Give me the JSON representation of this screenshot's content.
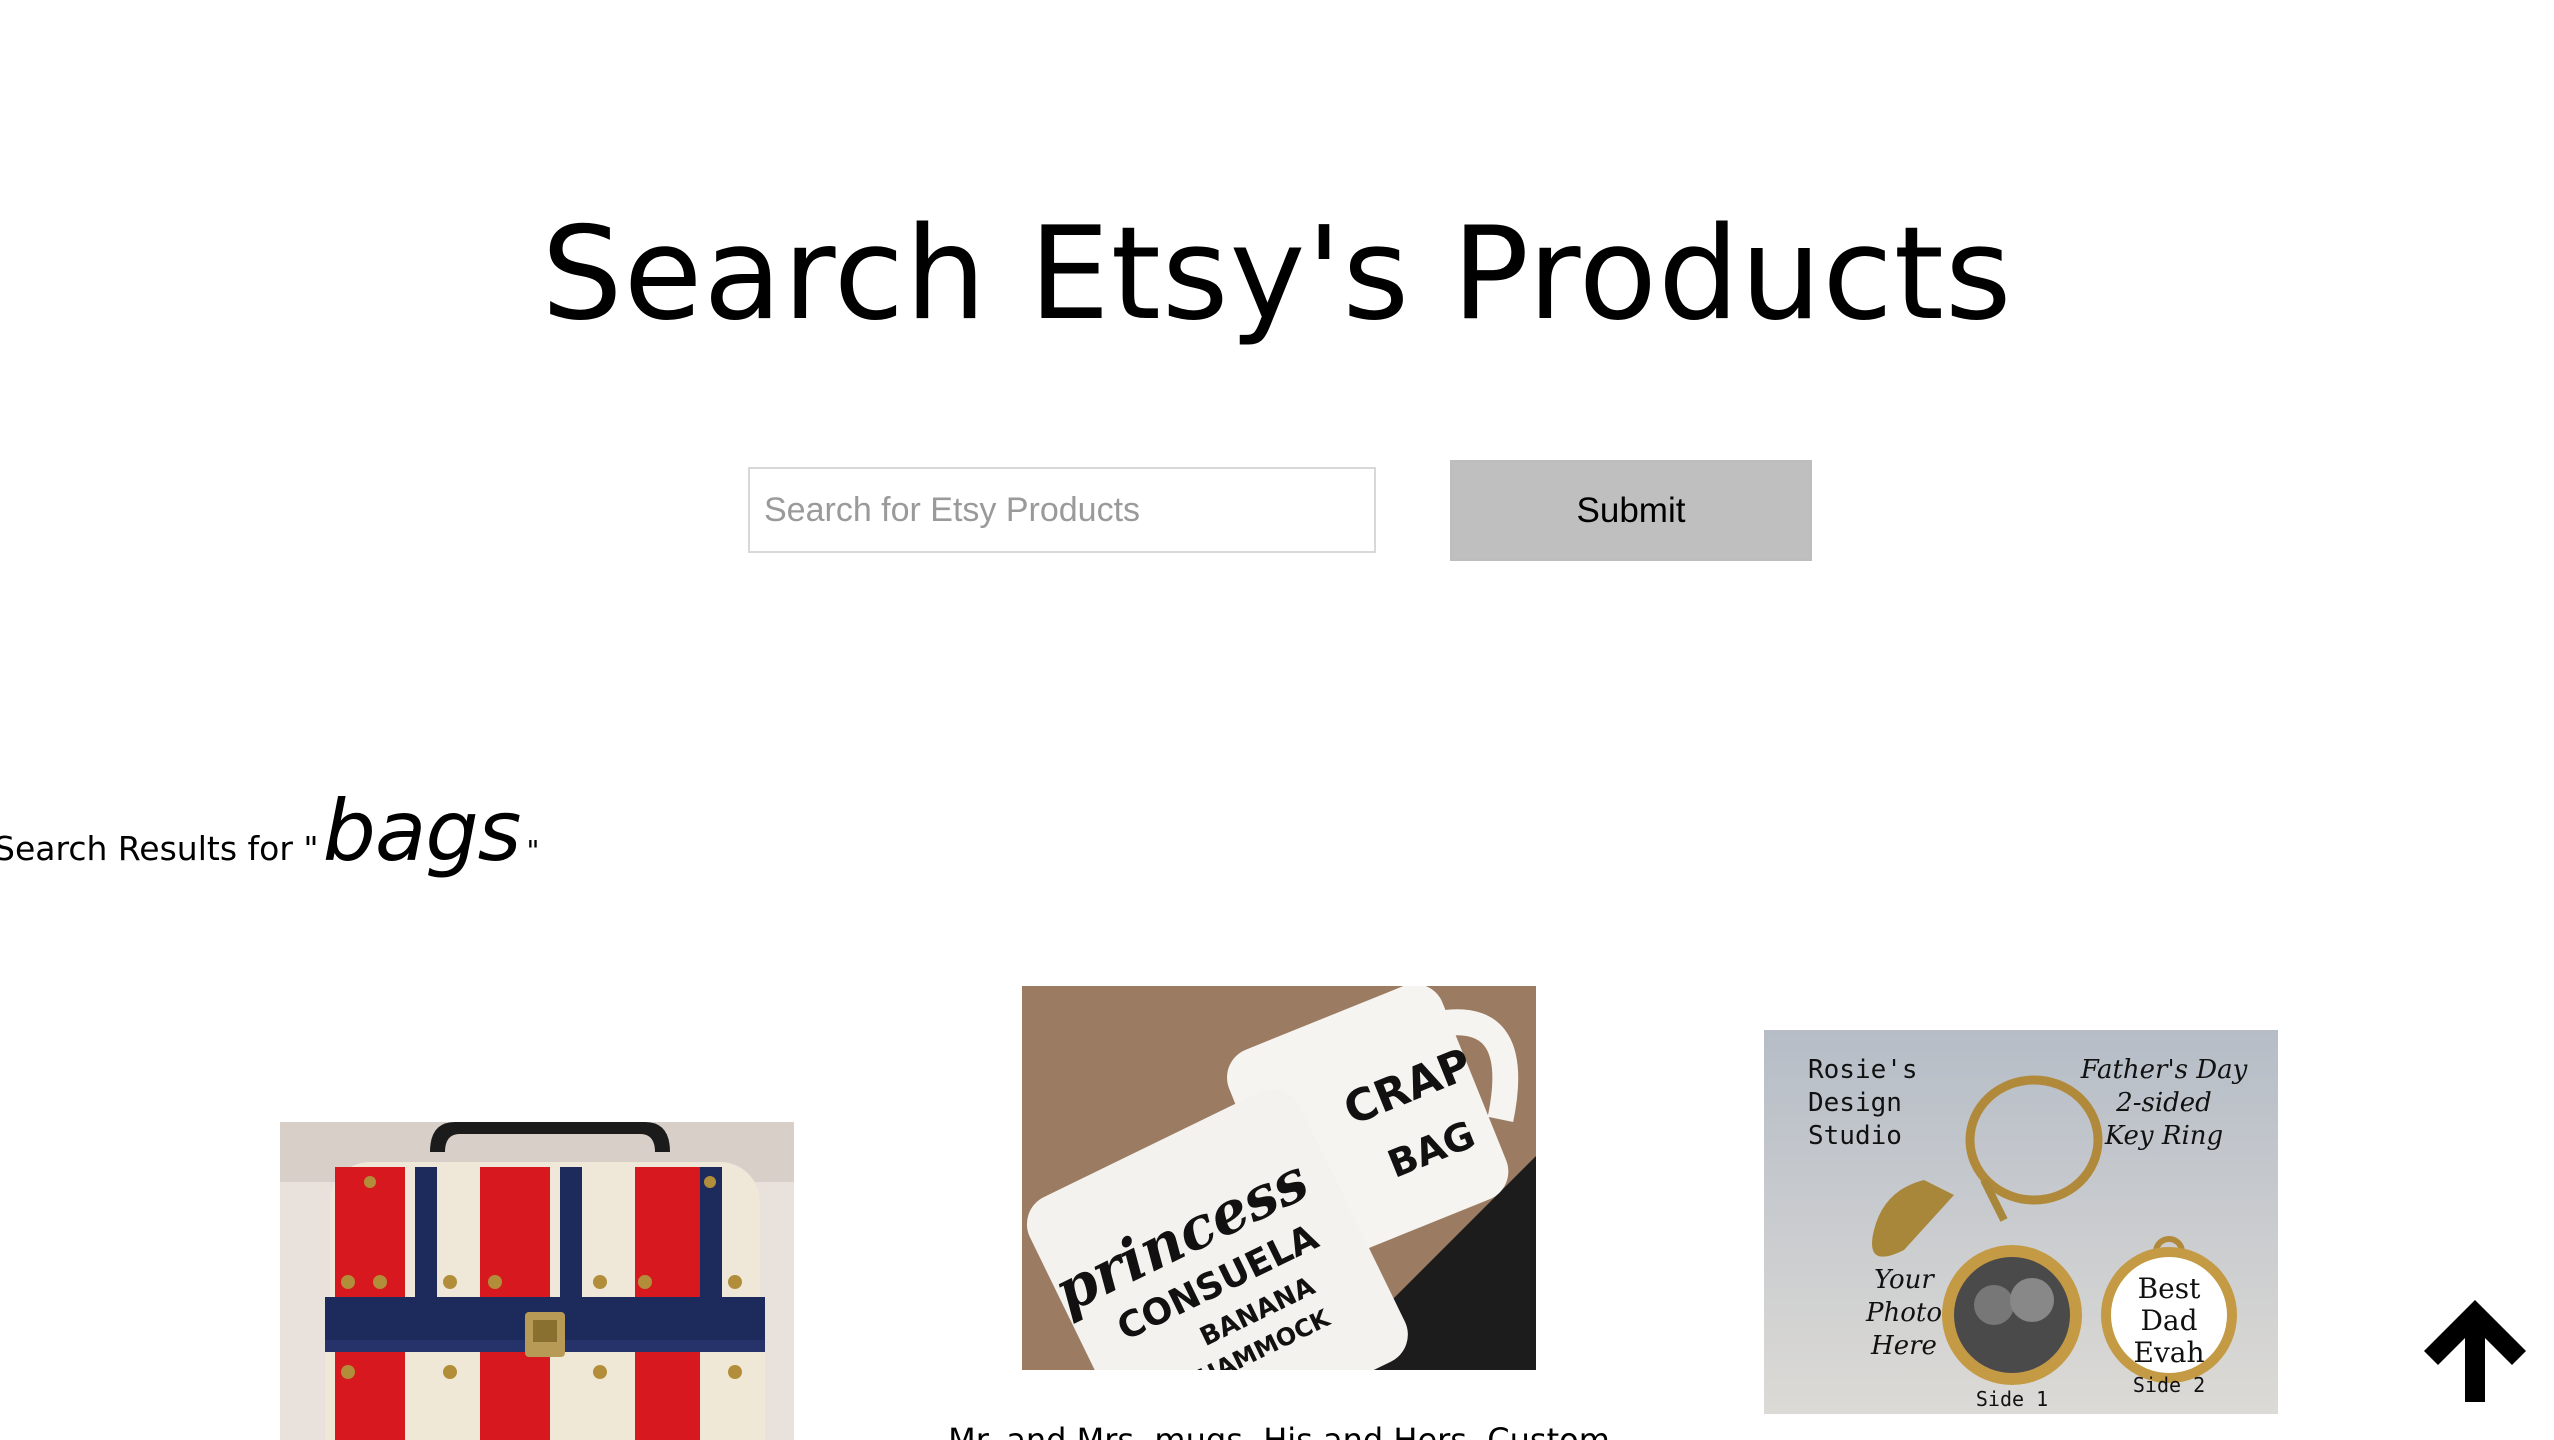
{
  "header": {
    "title": "Search Etsy's Products"
  },
  "search": {
    "placeholder": "Search for Etsy Products",
    "value": "",
    "submit_label": "Submit"
  },
  "results": {
    "prefix": "Search Results for \"",
    "query": "bags",
    "suffix": "\""
  },
  "products": [
    {
      "image_label": "red white and blue striped trunk-style handbag"
    },
    {
      "image_label": "two white mugs with hand lettering",
      "mug_text_1": "princess",
      "mug_text_2": "CONSUELA",
      "mug_text_3": "BANANA",
      "mug_text_4": "HAMMOCK",
      "mug_text_5": "CRAP",
      "mug_text_6": "BAG",
      "title": "Mr. and Mrs. mugs, His and Hers, Custom"
    },
    {
      "image_label": "Father's Day 2-sided key ring",
      "brand_line_1": "Rosie's",
      "brand_line_2": "Design",
      "brand_line_3": "Studio",
      "promo_line_1": "Father's Day",
      "promo_line_2": "2-sided",
      "promo_line_3": "Key Ring",
      "photo_line_1": "Your",
      "photo_line_2": "Photo",
      "photo_line_3": "Here",
      "pendant_line_1": "Best",
      "pendant_line_2": "Dad",
      "pendant_line_3": "Evah",
      "side_1": "Side 1",
      "side_2": "Side 2"
    }
  ],
  "colors": {
    "submit_bg": "#bfbfbf",
    "input_border": "#d8d8d8",
    "placeholder": "#9a9a9a"
  },
  "icons": {
    "scroll_top": "arrow-up-icon"
  }
}
